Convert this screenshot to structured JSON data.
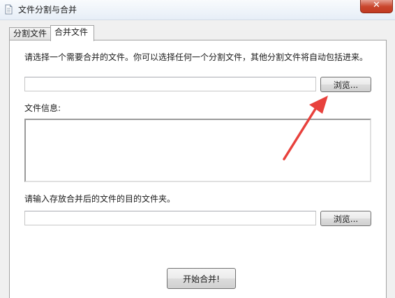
{
  "window": {
    "title": "文件分割与合并",
    "close_label": "✕"
  },
  "tabs": [
    {
      "label": "分割文件",
      "selected": false
    },
    {
      "label": "合并文件",
      "selected": true
    }
  ],
  "merge": {
    "instruction": "请选择一个需要合并的文件。你可以选择任何一个分割文件，其他分割文件将自动包括进来。",
    "file_input": "",
    "browse_label": "浏览...",
    "info_label": "文件信息:",
    "info_text": "",
    "dest_instruction": "请输入存放合并后的文件的目的文件夹。",
    "dest_input": "",
    "dest_browse_label": "浏览...",
    "start_label": "开始合并!"
  },
  "colors": {
    "annotation_arrow": "#e8413c",
    "close_button": "#c9462c"
  }
}
